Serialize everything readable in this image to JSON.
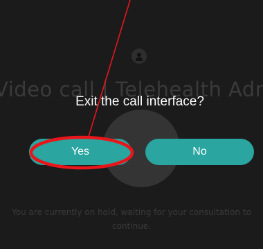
{
  "background": {
    "title": "Video call | Telehealth Admin",
    "status": "You are currently on hold, waiting for your consultation to continue.",
    "avatar_icon": "person-icon"
  },
  "dialog": {
    "question": "Exit the call interface?",
    "yes_label": "Yes",
    "no_label": "No"
  },
  "colors": {
    "accent": "#2aa5a0",
    "annotation": "#e8161b",
    "background": "#1b1b1b"
  }
}
